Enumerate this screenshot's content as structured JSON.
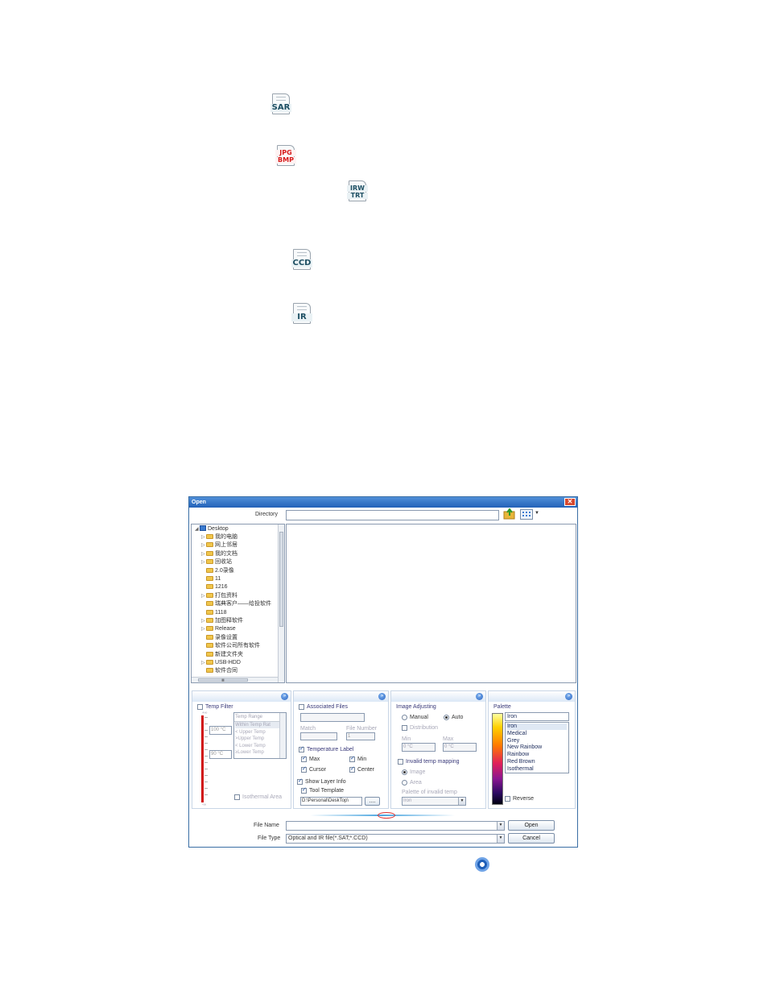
{
  "file_icons": [
    {
      "name": "sar-file-icon",
      "label": "SAR"
    },
    {
      "name": "jpg-bmp-file-icon",
      "label_top": "JPG",
      "label_bottom": "BMP"
    },
    {
      "name": "irw-trt-file-icon",
      "label_top": "IRW",
      "label_bottom": "TRT"
    },
    {
      "name": "ccd-file-icon",
      "label": "CCD"
    },
    {
      "name": "ir-file-icon",
      "label": "IR"
    }
  ],
  "dialog": {
    "title": "Open",
    "close_glyph": "✕",
    "directory_label": "Directory",
    "directory_value": "",
    "tree": {
      "root": "Desktop",
      "items": [
        "我的电脑",
        "网上邻居",
        "我的文档",
        "回收站",
        "2.0录像",
        "11",
        "1216",
        "打包资料",
        "瑞典客户——给投软件",
        "1118",
        "加图释软件",
        "Release",
        "录像设置",
        "软件公司所有软件",
        "新建文件夹",
        "USB-HDD",
        "软件合同"
      ],
      "hscroll_glyph": "Ⅲ"
    },
    "temp_filter": {
      "title": "Temp Filter",
      "scale_top": "+∞",
      "scale_bottom": "-∞",
      "range_header": "Temp Range",
      "range_options": [
        "Within Temp Rat",
        "< Upper Temp",
        ">Upper Temp",
        "< Lower Temp",
        "≥Lower Temp"
      ],
      "upper_value": "100 °C",
      "lower_value": "90 °C",
      "isothermal_label": "Isothermal Area"
    },
    "associated": {
      "title": "Associated Files",
      "match_label": "Match",
      "file_number_label": "File Number",
      "file_number_value": "1",
      "temperature_label": "Temperature Label",
      "max_label": "Max",
      "min_label": "Min",
      "cursor_label": "Cursor",
      "center_label": "Center",
      "show_layer_info": "Show Layer Info",
      "tool_template": "Tool Template",
      "template_path": "D:\\Personal\\DeskTop\\",
      "browse_label": "...."
    },
    "image_adjusting": {
      "title": "Image Adjusting",
      "manual_label": "Manual",
      "auto_label": "Auto",
      "distribution_label": "Distribution",
      "min_label": "Min",
      "max_label": "Max",
      "min_value": "0 °C",
      "max_value": "0 °C",
      "invalid_mapping_label": "Invalid temp mapping",
      "image_label": "Image",
      "area_label": "Area",
      "palette_invalid_label": "Palette of invalid temp",
      "palette_invalid_value": "Iron"
    },
    "palette": {
      "title": "Palette",
      "selected": "Iron",
      "options": [
        "Iron",
        "Medical",
        "Grey",
        "New Rainbow",
        "Rainbow",
        "Red Brown",
        "Isothermal"
      ],
      "reverse_label": "Reverse"
    },
    "file_name_label": "File Name",
    "file_name_value": "",
    "file_type_label": "File Type",
    "file_type_value": "Optical and IR file(*.SAT;*.CCD)",
    "open_button": "Open",
    "cancel_button": "Cancel"
  },
  "colors": {
    "title_bar": "#2361b8",
    "accent": "#3a6ea5"
  }
}
